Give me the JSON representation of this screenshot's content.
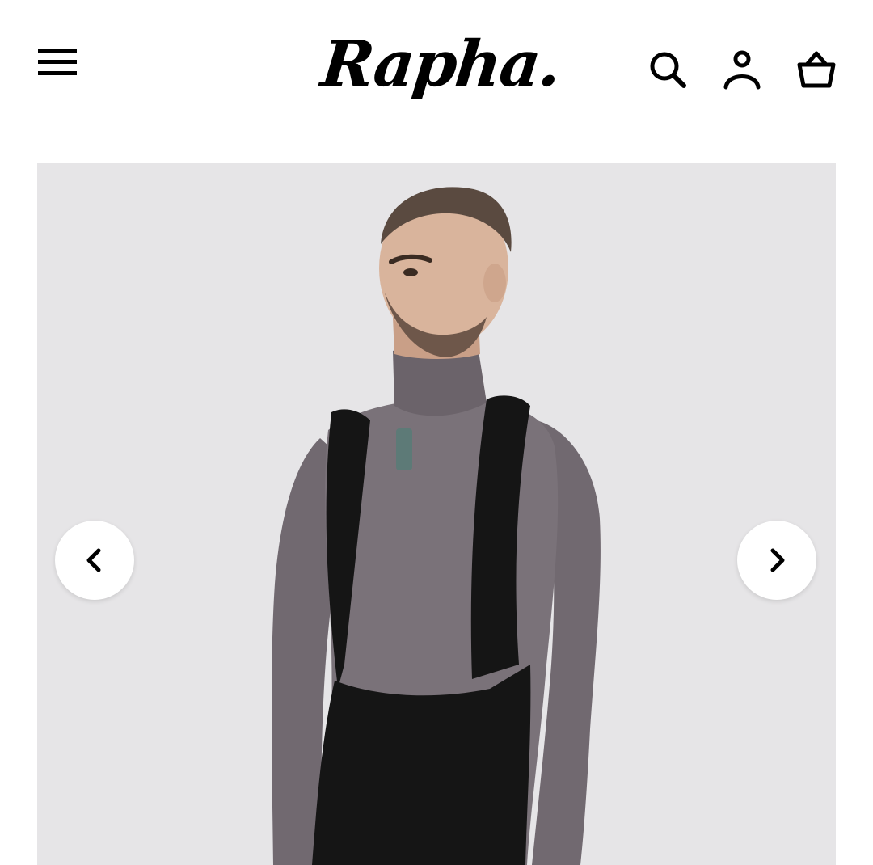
{
  "header": {
    "logo_text": "Rapha.",
    "menu_icon": "hamburger-menu-icon",
    "search_icon": "search-icon",
    "account_icon": "account-icon",
    "basket_icon": "basket-icon"
  },
  "gallery": {
    "image_alt": "",
    "prev_icon": "chevron-left-icon",
    "next_icon": "chevron-right-icon",
    "background_color": "#e6e5e7"
  },
  "colors": {
    "garment": "#716970",
    "bib": "#151515",
    "skin": "#d9b49c"
  }
}
